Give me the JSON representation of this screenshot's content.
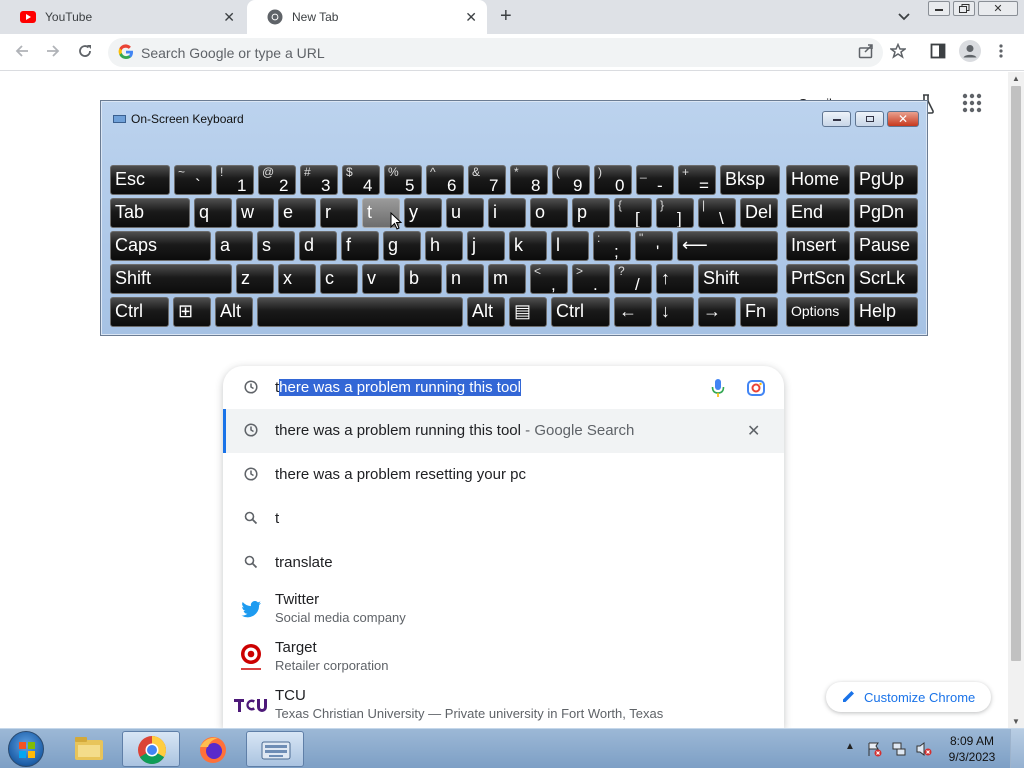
{
  "tabs": [
    {
      "title": "YouTube"
    },
    {
      "title": "New Tab"
    }
  ],
  "omnibox": {
    "placeholder": "Search Google or type a URL"
  },
  "ntp": {
    "gmail_partial": "Gmail",
    "customize_label": "Customize Chrome"
  },
  "osk": {
    "title": "On-Screen Keyboard",
    "rows": [
      [
        {
          "label": "Esc"
        },
        {
          "shift": "~",
          "base": "`"
        },
        {
          "shift": "!",
          "base": "1"
        },
        {
          "shift": "@",
          "base": "2"
        },
        {
          "shift": "#",
          "base": "3"
        },
        {
          "shift": "$",
          "base": "4"
        },
        {
          "shift": "%",
          "base": "5"
        },
        {
          "shift": "^",
          "base": "6"
        },
        {
          "shift": "&",
          "base": "7"
        },
        {
          "shift": "*",
          "base": "8"
        },
        {
          "shift": "(",
          "base": "9"
        },
        {
          "shift": ")",
          "base": "0"
        },
        {
          "shift": "_",
          "base": "-"
        },
        {
          "shift": "+",
          "base": "="
        },
        {
          "label": "Bksp"
        },
        {
          "label": "Home"
        },
        {
          "label": "PgUp"
        }
      ],
      [
        {
          "label": "Tab"
        },
        {
          "label": "q"
        },
        {
          "label": "w"
        },
        {
          "label": "e"
        },
        {
          "label": "r"
        },
        {
          "label": "t"
        },
        {
          "label": "y"
        },
        {
          "label": "u"
        },
        {
          "label": "i"
        },
        {
          "label": "o"
        },
        {
          "label": "p"
        },
        {
          "shift": "{",
          "base": "["
        },
        {
          "shift": "}",
          "base": "]"
        },
        {
          "shift": "|",
          "base": "\\"
        },
        {
          "label": "Del"
        },
        {
          "label": "End"
        },
        {
          "label": "PgDn"
        }
      ],
      [
        {
          "label": "Caps"
        },
        {
          "label": "a"
        },
        {
          "label": "s"
        },
        {
          "label": "d"
        },
        {
          "label": "f"
        },
        {
          "label": "g"
        },
        {
          "label": "h"
        },
        {
          "label": "j"
        },
        {
          "label": "k"
        },
        {
          "label": "l"
        },
        {
          "shift": ":",
          "base": ";"
        },
        {
          "shift": "\"",
          "base": "'"
        },
        {
          "label": "⟵"
        },
        {
          "label": "Insert"
        },
        {
          "label": "Pause"
        }
      ],
      [
        {
          "label": "Shift"
        },
        {
          "label": "z"
        },
        {
          "label": "x"
        },
        {
          "label": "c"
        },
        {
          "label": "v"
        },
        {
          "label": "b"
        },
        {
          "label": "n"
        },
        {
          "label": "m"
        },
        {
          "shift": "<",
          "base": ","
        },
        {
          "shift": ">",
          "base": "."
        },
        {
          "shift": "?",
          "base": "/"
        },
        {
          "label": "↑"
        },
        {
          "label": "Shift"
        },
        {
          "label": "PrtScn"
        },
        {
          "label": "ScrLk"
        }
      ],
      [
        {
          "label": "Ctrl"
        },
        {
          "label": "⊞"
        },
        {
          "label": "Alt"
        },
        {
          "label": ""
        },
        {
          "label": "Alt"
        },
        {
          "label": "▤"
        },
        {
          "label": "Ctrl"
        },
        {
          "label": "←"
        },
        {
          "label": "↓"
        },
        {
          "label": "→"
        },
        {
          "label": "Fn"
        },
        {
          "label": "Options"
        },
        {
          "label": "Help"
        }
      ]
    ]
  },
  "search": {
    "query_typed": "t",
    "query_completion": "here was a problem running this tool",
    "suggestions": [
      {
        "text": "there was a problem running this tool",
        "suffix": " - Google Search",
        "icon": "history-icon"
      },
      {
        "text": "there was a problem resetting your pc",
        "suffix": "",
        "icon": "history-icon"
      },
      {
        "text": "t",
        "suffix": "",
        "icon": "search-icon"
      },
      {
        "text": "translate",
        "suffix": "",
        "icon": "search-icon"
      }
    ],
    "entities": [
      {
        "name": "Twitter",
        "desc": "Social media company",
        "icon": "twitter-logo"
      },
      {
        "name": "Target",
        "desc": "Retailer corporation",
        "icon": "target-logo"
      },
      {
        "name": "TCU",
        "desc": "Texas Christian University — Private university in Fort Worth, Texas",
        "icon": "tcu-logo"
      }
    ]
  },
  "taskbar": {
    "time": "8:09 AM",
    "date": "9/3/2023"
  },
  "colors": {
    "accent": "#1a73e8",
    "selection": "#3367d6"
  }
}
